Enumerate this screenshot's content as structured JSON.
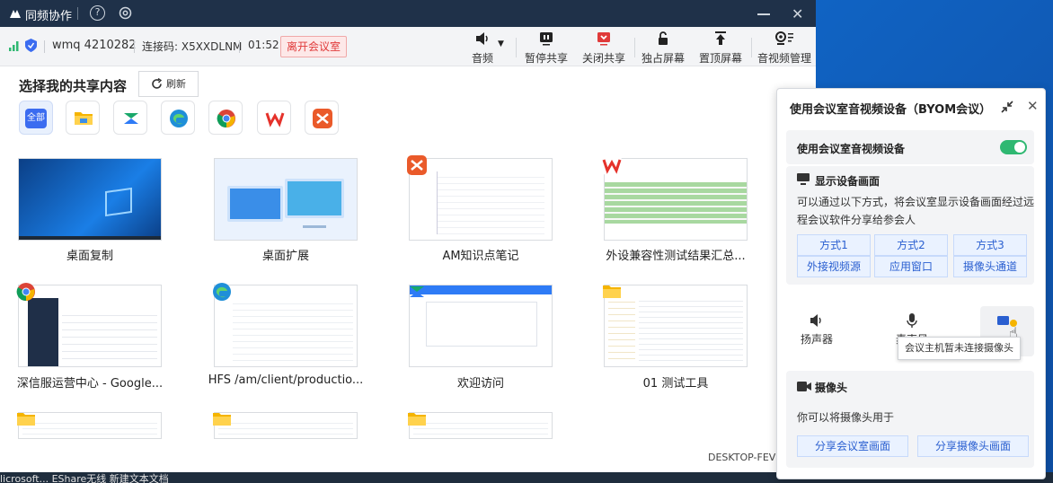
{
  "app": {
    "name": "同频协作"
  },
  "info": {
    "meeting_id": "wmq 4210282",
    "code_label": "连接码: X5XXDLNM",
    "timer": "01:52",
    "leave_label": "离开会议室"
  },
  "toolbar": [
    {
      "label": "音频",
      "icon": "speaker-icon"
    },
    {
      "label": "暂停共享",
      "icon": "pause-share-icon"
    },
    {
      "label": "关闭共享",
      "icon": "stop-share-icon"
    },
    {
      "label": "独占屏幕",
      "icon": "lock-icon"
    },
    {
      "label": "置顶屏幕",
      "icon": "pin-top-icon"
    },
    {
      "label": "音视频管理",
      "icon": "av-manage-icon"
    }
  ],
  "share": {
    "title": "选择我的共享内容",
    "refresh_label": "刷新",
    "filter_all": "全部",
    "items": [
      {
        "label": "桌面复制"
      },
      {
        "label": "桌面扩展"
      },
      {
        "label": "AM知识点笔记"
      },
      {
        "label": "外设兼容性测试结果汇总..."
      },
      {
        "label": "深信服运营中心 - Google..."
      },
      {
        "label": "HFS /am/client/productio..."
      },
      {
        "label": "欢迎访问"
      },
      {
        "label": "01 测试工具"
      }
    ]
  },
  "hostname": "DESKTOP-FEVE",
  "taskbar": {
    "text": "licrosoft...  EShare无线  新建文本文档"
  },
  "panel": {
    "title": "使用会议室音视频设备（BYOM会议）",
    "toggle_label": "使用会议室音视频设备",
    "display_title": "显示设备画面",
    "display_desc_1": "可以通过以下方式，将会议室显示设备画面经过远",
    "display_desc_2": "程会议软件分享给参会人",
    "options": [
      {
        "top": "方式1",
        "bottom": "外接视频源"
      },
      {
        "top": "方式2",
        "bottom": "应用窗口"
      },
      {
        "top": "方式3",
        "bottom": "摄像头通道"
      }
    ],
    "devices": {
      "speaker": "扬声器",
      "mic": "麦克风"
    },
    "tooltip": "会议主机暂未连接摄像头",
    "camera_title": "摄像头",
    "camera_desc": "你可以将摄像头用于",
    "camera_btn_1": "分享会议室画面",
    "camera_btn_2": "分享摄像头画面"
  },
  "colors": {
    "accent": "#3b6cf0",
    "danger": "#e03a3a",
    "toggle_on": "#2fb872",
    "titlebar": "#1f3149"
  }
}
